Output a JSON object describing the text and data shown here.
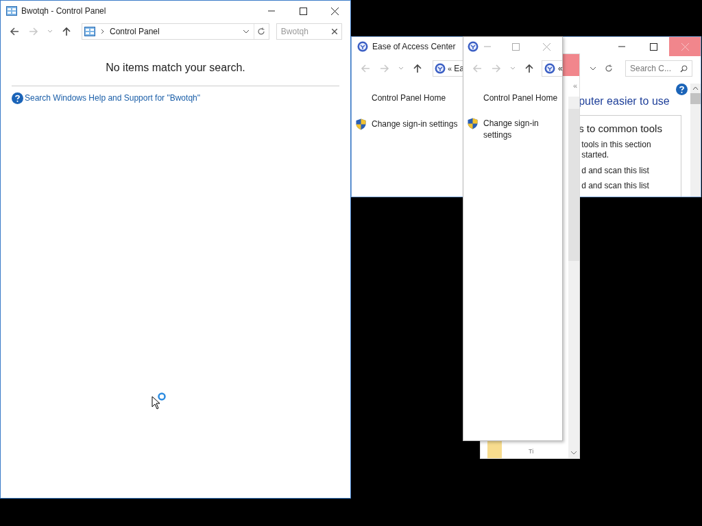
{
  "control_panel_window": {
    "title": "Bwotqh - Control Panel",
    "nav": {
      "back_enabled": true,
      "forward_enabled": false
    },
    "address": "Control Panel",
    "search_value": "Bwotqh",
    "message": "No items match your search.",
    "help_link": "Search Windows Help and Support for \"Bwotqh\""
  },
  "ease_of_access_window": {
    "title": "Ease of Access Center",
    "close_hovered": true,
    "nav": {
      "back_enabled": false,
      "forward_enabled": false
    },
    "address_prefix": "«",
    "address": "Ea",
    "search_placeholder": "Search C...",
    "sidebar": [
      "Control Panel Home",
      "Change sign-in settings"
    ],
    "heading": "puter easier to use",
    "section_title": "s to common tools",
    "lines": [
      "tools in this section",
      "started.",
      "d and scan this list",
      "d and scan this list"
    ]
  },
  "middle_window": {
    "close_hovered": true,
    "collapse": "«",
    "bottom_text": "Ti"
  },
  "front_window": {
    "nav": {
      "back_enabled": false,
      "forward_enabled": false
    },
    "address_prefix": "«",
    "sidebar": [
      "Control Panel Home",
      "Change sign-in settings"
    ]
  }
}
